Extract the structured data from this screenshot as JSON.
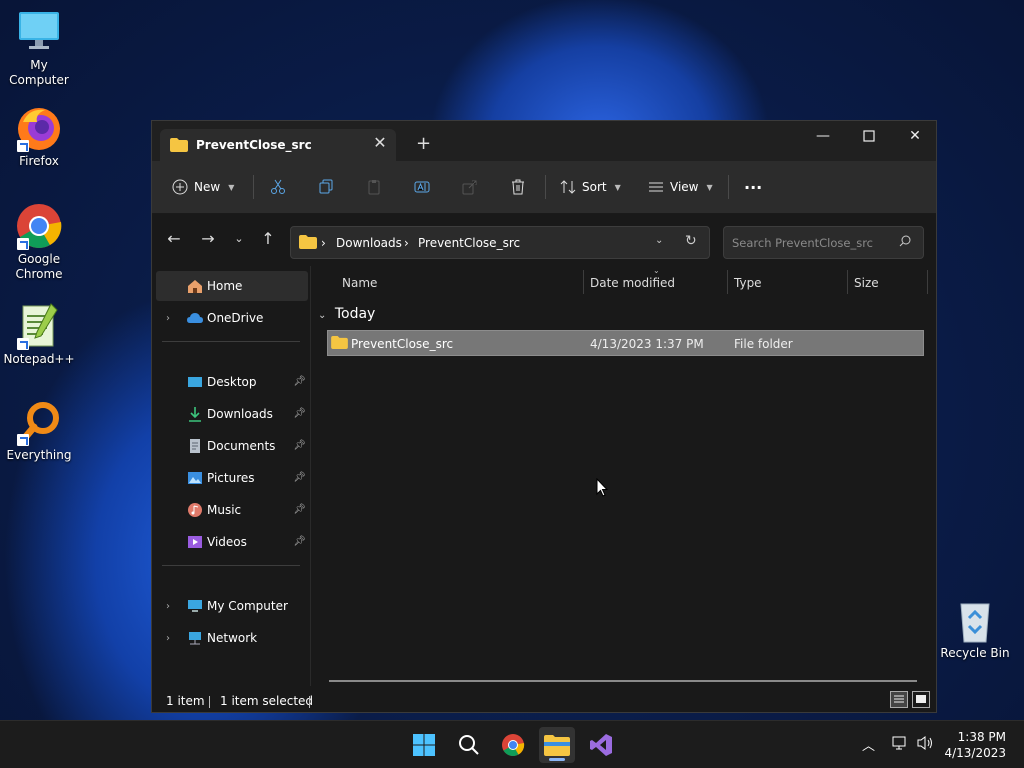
{
  "desktop": {
    "icons": [
      {
        "label": "My Computer",
        "icon": "monitor-icon"
      },
      {
        "label": "Firefox",
        "icon": "firefox-icon"
      },
      {
        "label": "Google Chrome",
        "icon": "chrome-icon"
      },
      {
        "label": "Notepad++",
        "icon": "notepadpp-icon"
      },
      {
        "label": "Everything",
        "icon": "search-magnifier-icon"
      }
    ],
    "recycle_bin": {
      "label": "Recycle Bin",
      "icon": "recycle-bin-icon"
    }
  },
  "window": {
    "tab_title": "PreventClose_src",
    "new_tab_symbol": "+",
    "commands": {
      "new": "New",
      "sort": "Sort",
      "view": "View",
      "more": "···"
    },
    "address": {
      "crumbs": [
        "Downloads",
        "PreventClose_src"
      ],
      "separator": "›"
    },
    "search_placeholder": "Search PreventClose_src",
    "nav": {
      "home": "Home",
      "onedrive": "OneDrive",
      "quick": [
        {
          "label": "Desktop",
          "icon": "desktop-icon"
        },
        {
          "label": "Downloads",
          "icon": "download-arrow-icon"
        },
        {
          "label": "Documents",
          "icon": "document-icon"
        },
        {
          "label": "Pictures",
          "icon": "pictures-icon"
        },
        {
          "label": "Music",
          "icon": "music-icon"
        },
        {
          "label": "Videos",
          "icon": "videos-icon"
        }
      ],
      "my_computer": "My Computer",
      "network": "Network"
    },
    "columns": {
      "name": "Name",
      "date_modified": "Date modified",
      "type": "Type",
      "size": "Size"
    },
    "group_label": "Today",
    "files": [
      {
        "name": "PreventClose_src",
        "date": "4/13/2023 1:37 PM",
        "type": "File folder",
        "size": ""
      }
    ],
    "status": {
      "count": "1 item",
      "selected": "1 item selected"
    }
  },
  "taskbar": {
    "apps": [
      "start-icon",
      "search-icon",
      "chrome-icon",
      "file-explorer-icon",
      "visual-studio-icon"
    ],
    "time": "1:38 PM",
    "date": "4/13/2023"
  },
  "colors": {
    "accent_folder": "#f5c542",
    "selection": "#777777",
    "taskbar": "#1c1c1c"
  }
}
